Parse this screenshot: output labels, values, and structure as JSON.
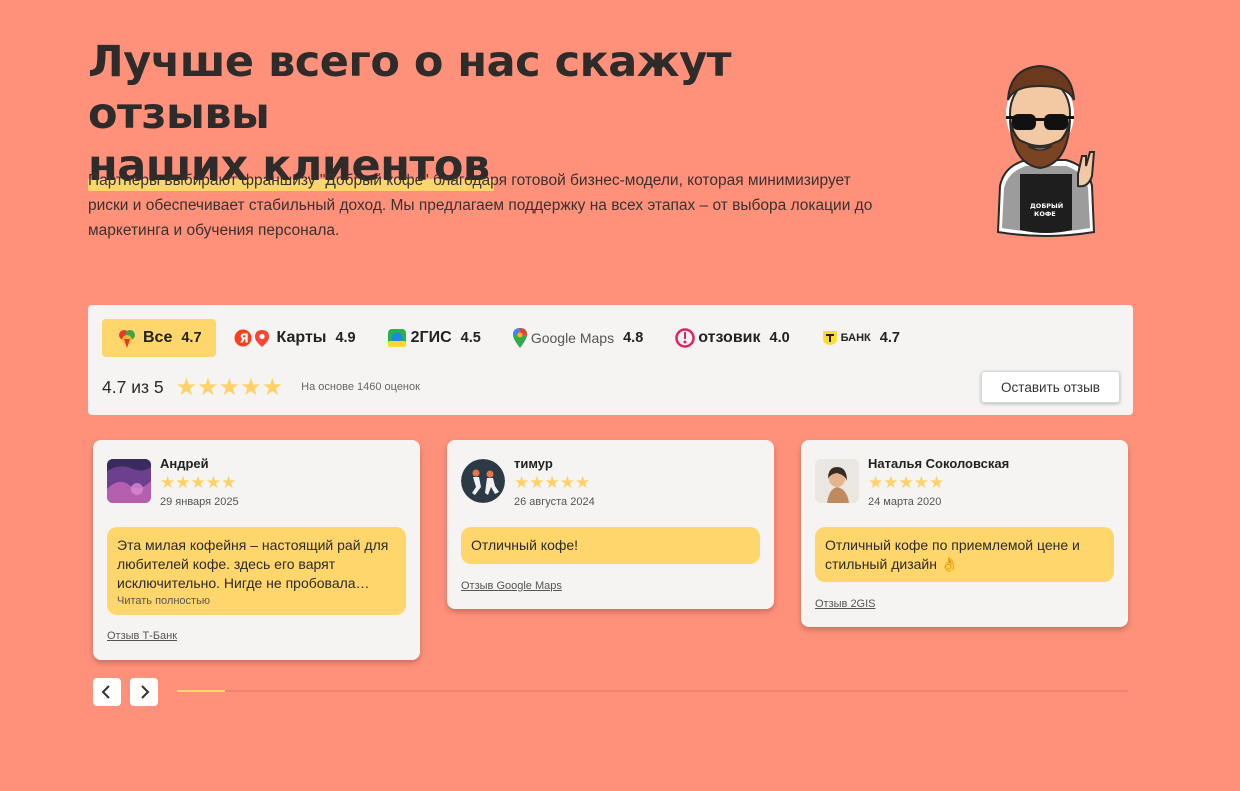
{
  "hero": {
    "title_line1": "Лучше всего о нас скажут отзывы",
    "title_line2": "наших клиентов",
    "description": "Партнеры выбирают франшизу \"Добрый кофе\" благодаря готовой бизнес-модели, которая минимизирует риски и обеспечивает стабильный доход. Мы предлагаем поддержку на всех этапах – от выбора локации до маркетинга и обучения персонала.",
    "mascot_apron_text": "ДОБРЫЙ КОФЕ"
  },
  "tabs": [
    {
      "label": "Все",
      "rating": "4.7",
      "icon": "all-sources-icon",
      "active": true
    },
    {
      "label": "Карты",
      "rating": "4.9",
      "icon": "yandex-maps-icon",
      "active": false
    },
    {
      "label": "2ГИС",
      "rating": "4.5",
      "icon": "2gis-icon",
      "active": false
    },
    {
      "label": "Google Maps",
      "rating": "4.8",
      "icon": "google-maps-icon",
      "active": false
    },
    {
      "label": "отзовик",
      "rating": "4.0",
      "icon": "otzovik-icon",
      "active": false
    },
    {
      "label": "БАНК",
      "rating": "4.7",
      "icon": "tbank-icon",
      "active": false
    }
  ],
  "summary": {
    "score_text": "4.7 из 5",
    "stars": 5,
    "basis": "На основе 1460 оценок",
    "leave_review_label": "Оставить отзыв"
  },
  "reviews": [
    {
      "name": "Андрей",
      "stars": 5,
      "date": "29 января 2025",
      "text": "Эта милая кофейня – настоящий рай для любителей кофе. здесь его варят исключительно. Нигде не пробовала…",
      "read_more": "Читать полностью",
      "source": "Отзыв Т-Банк",
      "avatar": "purple-landscape-avatar"
    },
    {
      "name": "тимур",
      "stars": 5,
      "date": "26 августа 2024",
      "text": "Отличный кофе!",
      "read_more": "",
      "source": "Отзыв Google Maps",
      "avatar": "martial-arts-avatar"
    },
    {
      "name": "Наталья Соколовская",
      "stars": 5,
      "date": "24 марта 2020",
      "text": "Отличный кофе по приемлемой цене и стильный дизайн 👌",
      "read_more": "",
      "source": "Отзыв 2GIS",
      "avatar": "woman-photo-avatar"
    }
  ],
  "carousel": {
    "prev_icon": "chevron-left-icon",
    "next_icon": "chevron-right-icon",
    "progress": 0.05
  },
  "colors": {
    "background": "#ff917a",
    "accent_yellow": "#ffd66b",
    "star": "#ffd166",
    "card": "#f5f4f2"
  }
}
